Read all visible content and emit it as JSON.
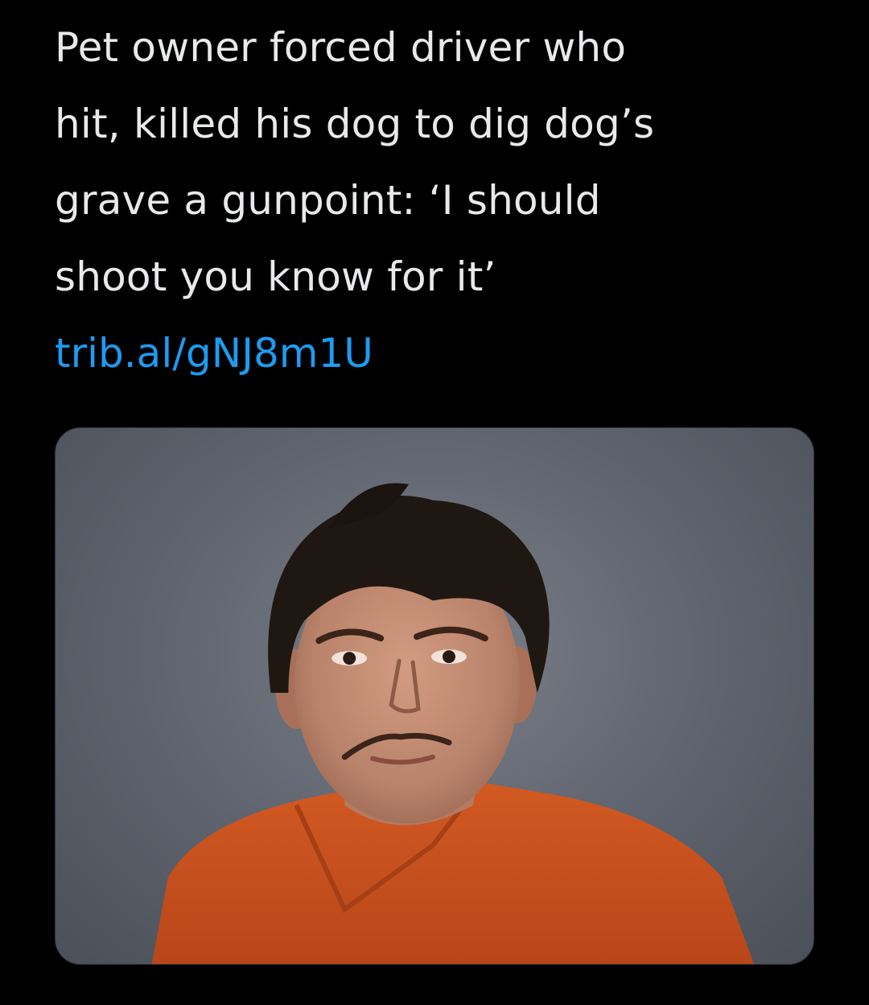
{
  "tweet": {
    "text": "Pet owner forced driver who\nhit, killed his dog to dig dog’s\ngrave a gunpoint: ‘I should\nshoot you know for it’",
    "link": "trib.al/gNJ8m1U"
  },
  "media": {
    "type": "photo",
    "subject": "booking-photo",
    "colors": {
      "backdrop": "#676c75",
      "shirt": "#c9531f",
      "hair": "#1f1712",
      "skin": "#c48f76"
    }
  },
  "colors": {
    "background": "#000000",
    "text": "#e7e9ea",
    "link": "#1d9bf0"
  }
}
